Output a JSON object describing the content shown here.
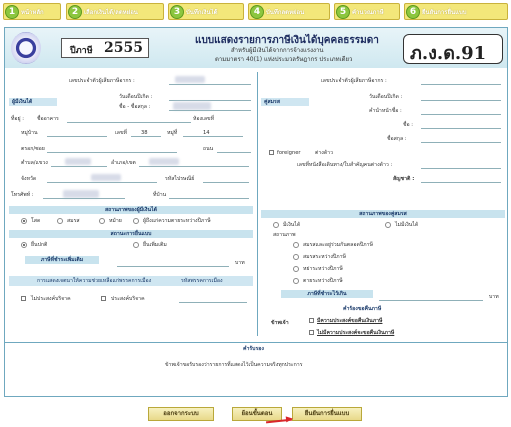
{
  "steps": [
    {
      "num": "1",
      "label": "หน้าหลัก"
    },
    {
      "num": "2",
      "label": "เลือกเงินได้/ลดหย่อน"
    },
    {
      "num": "3",
      "label": "บันทึกเงินได้"
    },
    {
      "num": "4",
      "label": "บันทึกลดหย่อน"
    },
    {
      "num": "5",
      "label": "คำนวณภาษี"
    },
    {
      "num": "6",
      "label": "ยืนยันการยื่นแบบ"
    }
  ],
  "header": {
    "year_label": "ปีภาษี",
    "year": "2555",
    "title": "แบบแสดงรายการภาษีเงินได้บุคคลธรรมดา",
    "subtitle1": "สำหรับผู้มีเงินได้จากการจ้างแรงงาน",
    "subtitle2": "ตามมาตรา 40(1) แห่งประมวลรัษฎากร ประเภทเดียว",
    "form_code": "ภ.ง.ด.91"
  },
  "left": {
    "taxid_label": "เลขประจำตัวผู้เสียภาษีอากร :",
    "section": "ผู้มีเงินได้",
    "birth_label": "วันเดือนปีเกิด :",
    "name_label": "ชื่อ - ชื่อสกุล :",
    "address_label": "ที่อยู่ :",
    "building_label": "ชื่ออาคาร",
    "room_label": "ห้องเลขที่",
    "village_label": "หมู่บ้าน",
    "no_label": "เลขที่",
    "no_value": "38",
    "moo_label": "หมู่ที่",
    "moo_value": "14",
    "soi_label": "ตรอก/ซอย",
    "road_label": "ถนน",
    "tambon_label": "ตำบล/แขวง",
    "amphoe_label": "อำเภอ/เขต",
    "province_label": "จังหวัด",
    "zip_label": "รหัสไปรษณีย์",
    "phone_label": "โทรศัพท์ :",
    "ext_label": "ที่บ้าน",
    "status_title": "สถานภาพของผู้มีเงินได้",
    "status_opts": [
      "โสด",
      "สมรส",
      "หม้าย",
      "ผู้ถึงแก่ความตายระหว่างปีภาษี"
    ],
    "filing_title": "สถานะการยื่นแบบ",
    "filing_opts": [
      "ยื่นปกติ",
      "ยื่นเพิ่มเติม"
    ],
    "extra_tax_label": "ภาษีที่ชำระเพิ่มเติม",
    "baht": "บาท",
    "donate_label": "การแสดงเจตนาให้ความช่วยเหลือแก่พรรคการเมือง",
    "party_label": "รหัสพรรคการเมือง",
    "no_donate": "ไม่ประสงค์บริจาค",
    "donate": "ประสงค์บริจาค"
  },
  "right": {
    "taxid_label": "เลขประจำตัวผู้เสียภาษีอากร :",
    "section": "คู่สมรส",
    "birth_label": "วันเดือนปีเกิด :",
    "prefix_label": "คำนำหน้าชื่อ :",
    "name_label": "ชื่อ :",
    "surname_label": "ชื่อสกุล :",
    "foreigner_label": "foreigner",
    "foreigner_hint": "ต่างด้าว",
    "passport_label": "เลขที่หนังสือเดินทาง/ใบสำคัญคนต่างด้าว :",
    "nationality_label": "สัญชาติ :",
    "status_title": "สถานภาพของคู่สมรส",
    "income_opts": [
      "มีเงินได้",
      "ไม่มีเงินได้"
    ],
    "status_label": "สถานภาพ",
    "status_opts": [
      "สมรสและอยู่ร่วมกันตลอดปีภาษี",
      "สมรสระหว่างปีภาษี",
      "หย่าระหว่างปีภาษี",
      "ตายระหว่างปีภาษี"
    ],
    "refund_label": "ภาษีที่ชำระไว้เกิน",
    "baht": "บาท",
    "refund_title": "คำร้องขอคืนภาษี",
    "refund_note": "ข้าพเจ้า",
    "refund_opts": [
      "มีความประสงค์ขอคืนเงินภาษี",
      "ไม่มีความประสงค์จะขอคืนเงินภาษี"
    ]
  },
  "cert": {
    "title": "คำรับรอง",
    "text": "ข้าพเจ้าขอรับรองว่ารายการที่แสดงไว้เป็นความจริงทุกประการ"
  },
  "buttons": {
    "back": "ออกจากระบบ",
    "prev": "ย้อนขั้นตอน",
    "confirm": "ยืนยันการยื่นแบบ"
  },
  "colors": {
    "step_bg": "#f3e77a",
    "step_num": "#8cc63f",
    "bar": "#c8e3ee",
    "accent_red": "#d9262a"
  }
}
